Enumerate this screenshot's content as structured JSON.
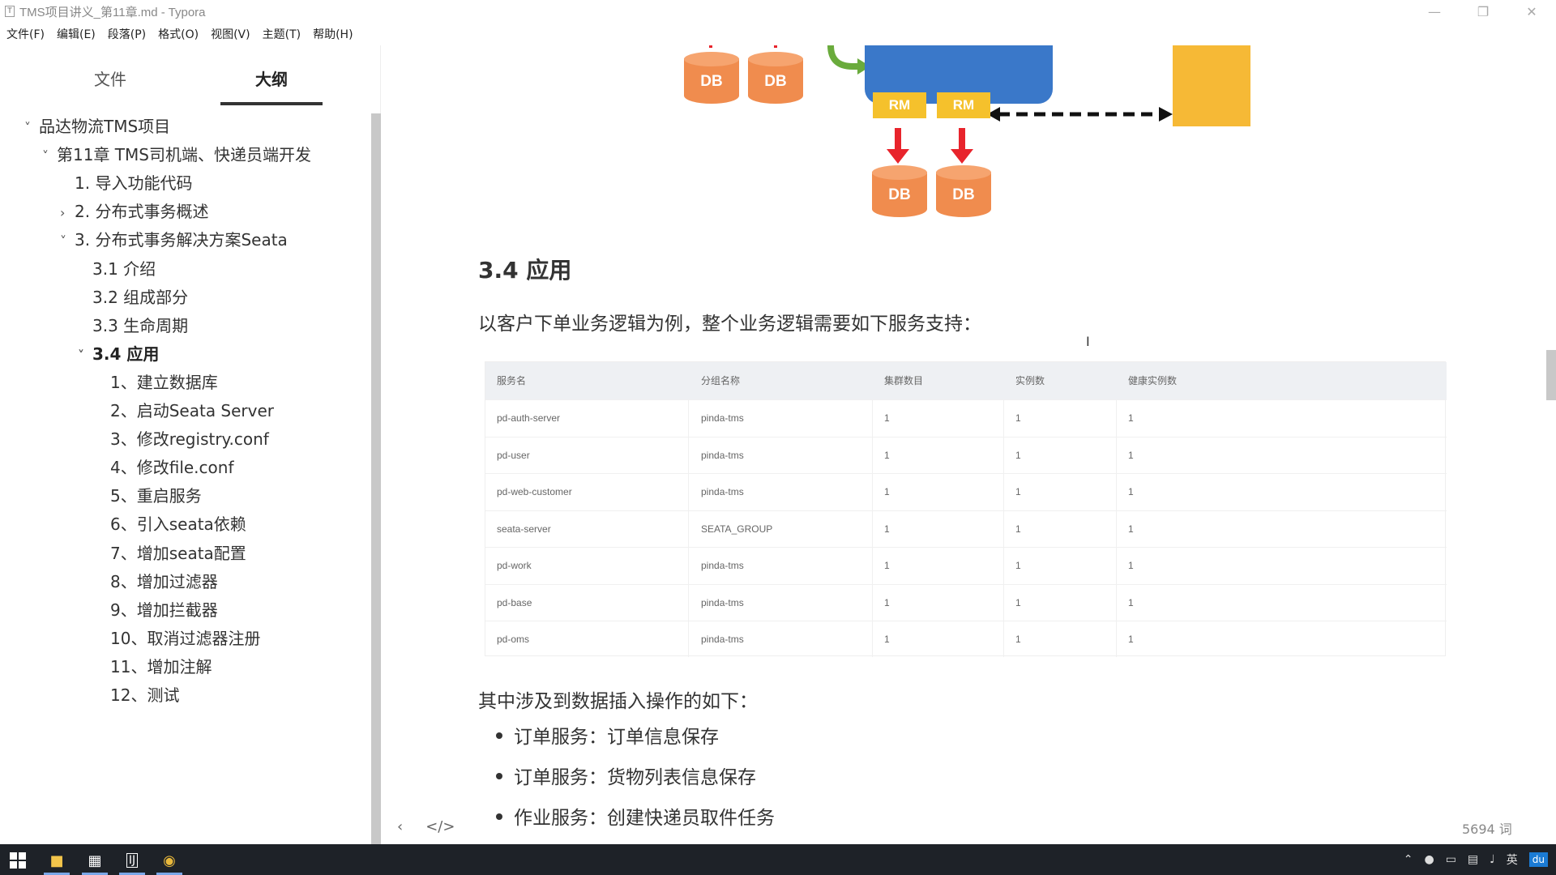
{
  "window": {
    "title": "TMS项目讲义_第11章.md - Typora",
    "icon": "typora-icon"
  },
  "menu": [
    "文件(F)",
    "编辑(E)",
    "段落(P)",
    "格式(O)",
    "视图(V)",
    "主题(T)",
    "帮助(H)"
  ],
  "sidebar": {
    "tabs": [
      "文件",
      "大纲"
    ],
    "active_tab": "大纲",
    "outline": [
      {
        "label": "品达物流TMS项目",
        "level": 0,
        "chevron": "down"
      },
      {
        "label": "第11章 TMS司机端、快递员端开发",
        "level": 1,
        "chevron": "down"
      },
      {
        "label": "1. 导入功能代码",
        "level": 2,
        "chevron": ""
      },
      {
        "label": "2. 分布式事务概述",
        "level": 2,
        "chevron": "right"
      },
      {
        "label": "3. 分布式事务解决方案Seata",
        "level": 2,
        "chevron": "down"
      },
      {
        "label": "3.1 介绍",
        "level": 3,
        "chevron": ""
      },
      {
        "label": "3.2 组成部分",
        "level": 3,
        "chevron": ""
      },
      {
        "label": "3.3 生命周期",
        "level": 3,
        "chevron": ""
      },
      {
        "label": "3.4 应用",
        "level": 3,
        "chevron": "down",
        "bold": true
      },
      {
        "label": "1、建立数据库",
        "level": 4,
        "chevron": ""
      },
      {
        "label": "2、启动Seata Server",
        "level": 4,
        "chevron": ""
      },
      {
        "label": "3、修改registry.conf",
        "level": 4,
        "chevron": ""
      },
      {
        "label": "4、修改file.conf",
        "level": 4,
        "chevron": ""
      },
      {
        "label": "5、重启服务",
        "level": 4,
        "chevron": ""
      },
      {
        "label": "6、引入seata依赖",
        "level": 4,
        "chevron": ""
      },
      {
        "label": "7、增加seata配置",
        "level": 4,
        "chevron": ""
      },
      {
        "label": "8、增加过滤器",
        "level": 4,
        "chevron": ""
      },
      {
        "label": "9、增加拦截器",
        "level": 4,
        "chevron": ""
      },
      {
        "label": "10、取消过滤器注册",
        "level": 4,
        "chevron": ""
      },
      {
        "label": "11、增加注解",
        "level": 4,
        "chevron": ""
      },
      {
        "label": "12、测试",
        "level": 4,
        "chevron": ""
      }
    ]
  },
  "diagram": {
    "db_label": "DB",
    "rm_label": "RM",
    "colors": {
      "db": "#f08c4e",
      "tm_box": "#3a78c9",
      "rm": "#f5c12c",
      "tc_box": "#f6b936",
      "arrow_red": "#e8242c",
      "arrow_green": "#6aab3c"
    }
  },
  "content": {
    "heading": "3.4 应用",
    "intro": "以客户下单业务逻辑为例，整个业务逻辑需要如下服务支持：",
    "table": {
      "headers": [
        "服务名",
        "分组名称",
        "集群数目",
        "实例数",
        "健康实例数"
      ],
      "rows": [
        [
          "pd-auth-server",
          "pinda-tms",
          "1",
          "1",
          "1"
        ],
        [
          "pd-user",
          "pinda-tms",
          "1",
          "1",
          "1"
        ],
        [
          "pd-web-customer",
          "pinda-tms",
          "1",
          "1",
          "1"
        ],
        [
          "seata-server",
          "SEATA_GROUP",
          "1",
          "1",
          "1"
        ],
        [
          "pd-work",
          "pinda-tms",
          "1",
          "1",
          "1"
        ],
        [
          "pd-base",
          "pinda-tms",
          "1",
          "1",
          "1"
        ],
        [
          "pd-oms",
          "pinda-tms",
          "1",
          "1",
          "1"
        ]
      ]
    },
    "insert_intro": "其中涉及到数据插入操作的如下：",
    "bullets": [
      "订单服务：订单信息保存",
      "订单服务：货物列表信息保存",
      "作业服务：创建快递员取件任务"
    ]
  },
  "status": {
    "word_count": "5694 词"
  },
  "taskbar": {
    "apps": [
      "windows-start-icon",
      "file-explorer-icon",
      "typora-icon",
      "intellij-icon",
      "chrome-icon"
    ],
    "tray_ime": "英",
    "tray_badge": "du"
  }
}
